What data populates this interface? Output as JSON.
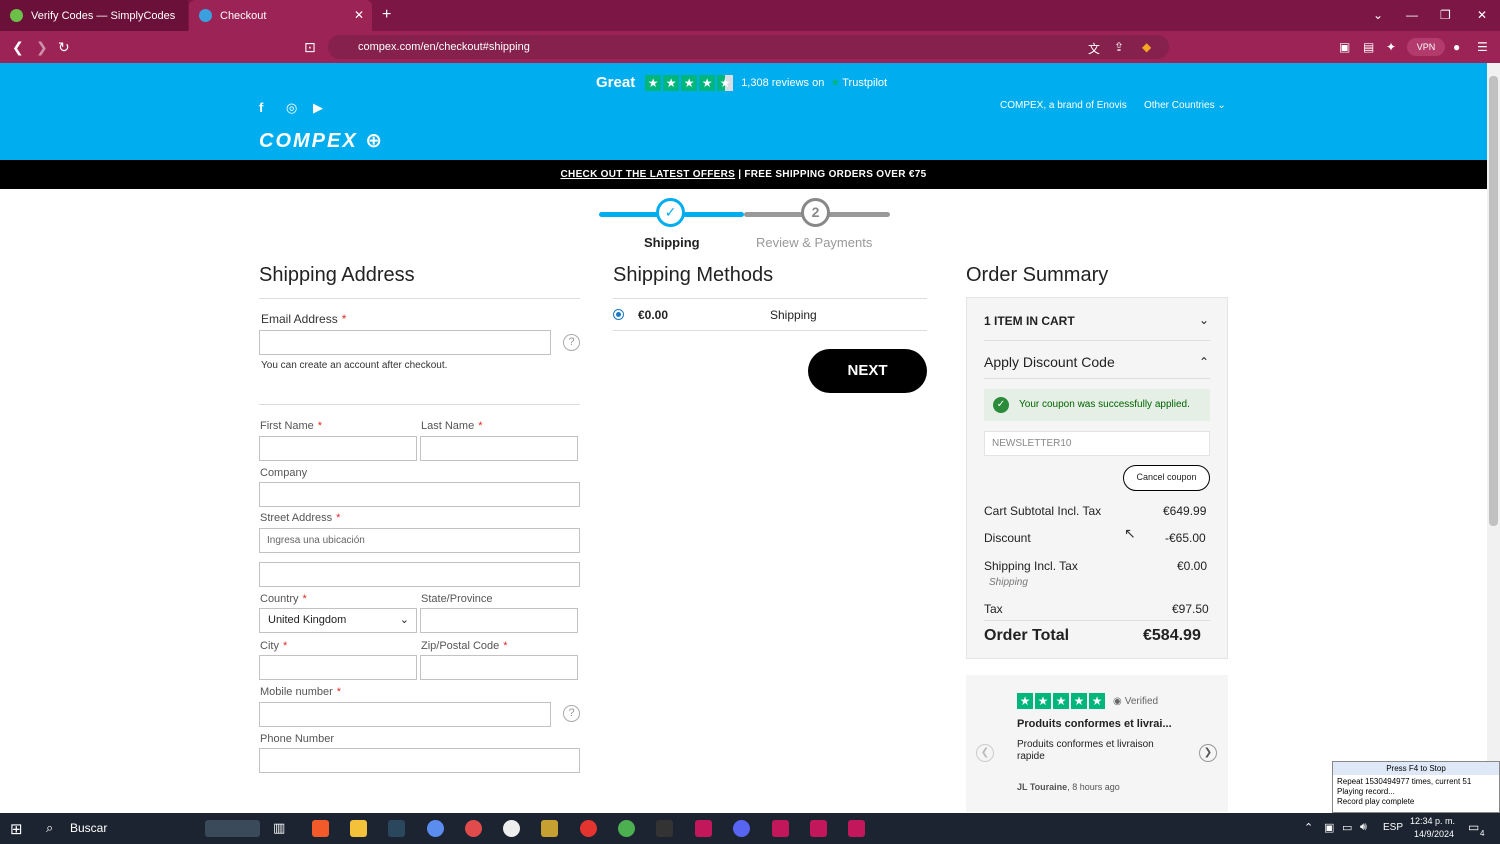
{
  "browser": {
    "tabs": [
      {
        "title": "Verify Codes — SimplyCodes"
      },
      {
        "title": "Checkout"
      }
    ],
    "url": "compex.com/en/checkout#shipping",
    "vpn_label": "VPN"
  },
  "header": {
    "trustpilot": {
      "rating_word": "Great",
      "reviews": "1,308 reviews on",
      "brand": "Trustpilot"
    },
    "logo": "COMPEX",
    "brand_link": "COMPEX, a brand of Enovis",
    "countries": "Other Countries"
  },
  "promo": {
    "link": "CHECK OUT THE LATEST OFFERS",
    "text": " | FREE SHIPPING ORDERS OVER €75"
  },
  "steps": [
    {
      "number": "1",
      "label": "Shipping"
    },
    {
      "number": "2",
      "label": "Review & Payments"
    }
  ],
  "shipping_address": {
    "title": "Shipping Address",
    "email_label": "Email Address",
    "email_note": "You can create an account after checkout.",
    "first_name": "First Name",
    "last_name": "Last Name",
    "company": "Company",
    "street": "Street Address",
    "street_placeholder": "Ingresa una ubicación",
    "country": "Country",
    "country_value": "United Kingdom",
    "state": "State/Province",
    "city": "City",
    "zip": "Zip/Postal Code",
    "mobile": "Mobile number",
    "phone": "Phone Number"
  },
  "shipping_methods": {
    "title": "Shipping Methods",
    "price": "€0.00",
    "method": "Shipping",
    "next": "NEXT"
  },
  "order_summary": {
    "title": "Order Summary",
    "items": "1 ITEM IN CART",
    "discount_title": "Apply Discount Code",
    "success": "Your coupon was successfully applied.",
    "coupon_code": "NEWSLETTER10",
    "cancel": "Cancel coupon",
    "subtotal_label": "Cart Subtotal Incl. Tax",
    "subtotal": "€649.99",
    "discount_label": "Discount",
    "discount": "-€65.00",
    "shipping_label": "Shipping Incl. Tax",
    "shipping_sub": "Shipping",
    "shipping": "€0.00",
    "tax_label": "Tax",
    "tax": "€97.50",
    "total_label": "Order Total",
    "total": "€584.99"
  },
  "review": {
    "verified": "Verified",
    "title": "Produits conformes et livrai...",
    "body": "Produits conformes et livraison rapide",
    "author": "JL Touraine",
    "time": ", 8 hours ago"
  },
  "overlay": {
    "title": "Press F4 to Stop",
    "line1": "Repeat 1530494977 times, current 51",
    "line2": "Playing record...",
    "line3": "Record play complete"
  },
  "taskbar": {
    "search": "Buscar",
    "lang": "ESP",
    "time": "12:34 p. m.",
    "date": "14/9/2024",
    "notif": "4"
  },
  "colors": {
    "header_blue": "#00aeef",
    "browser": "#9c2356",
    "success_green": "#2a8c3a"
  }
}
